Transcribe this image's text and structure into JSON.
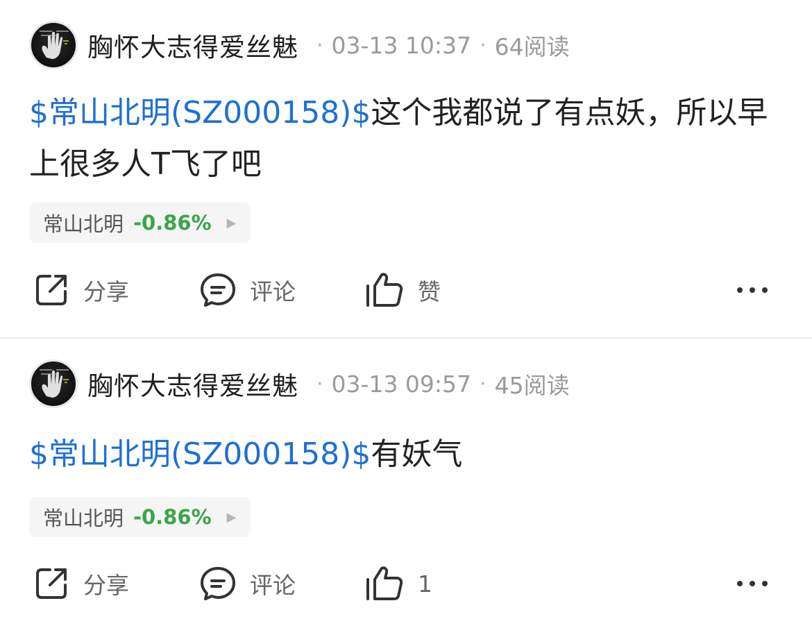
{
  "posts": [
    {
      "author": "胸怀大志得爱丝魅",
      "date": "03-13 10:37",
      "reads": "64阅读",
      "stock_link": "$常山北明(SZ000158)$",
      "text": "这个我都说了有点妖，所以早上很多人T飞了吧",
      "chip": {
        "name": "常山北明",
        "change": "-0.86%"
      },
      "actions": {
        "share": "分享",
        "comment": "评论",
        "like": "赞"
      }
    },
    {
      "author": "胸怀大志得爱丝魅",
      "date": "03-13 09:57",
      "reads": "45阅读",
      "stock_link": "$常山北明(SZ000158)$",
      "text": "有妖气",
      "chip": {
        "name": "常山北明",
        "change": "-0.86%"
      },
      "actions": {
        "share": "分享",
        "comment": "评论",
        "like": "1"
      }
    }
  ],
  "separator": "·",
  "icons": {
    "avatar": "avatar-hand-image",
    "share": "share-icon",
    "comment": "comment-icon",
    "like": "thumbs-up-icon",
    "more": "more-dots-icon",
    "chip_arrow": "play-triangle-icon"
  },
  "colors": {
    "link": "#1f6fd6",
    "change_positive": "#3aa64a",
    "meta": "#9a9a9a",
    "chip_bg": "#f5f5f6"
  }
}
